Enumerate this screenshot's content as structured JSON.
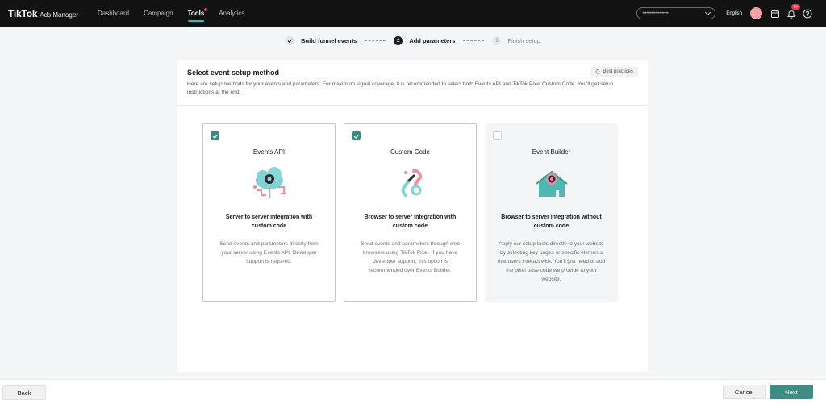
{
  "topbar": {
    "logo_main": "TikTok",
    "logo_sub": "Ads Manager",
    "nav": [
      {
        "label": "Dashboard",
        "active": false
      },
      {
        "label": "Campaign",
        "active": false
      },
      {
        "label": "Tools",
        "active": true
      },
      {
        "label": "Analytics",
        "active": false
      }
    ],
    "account_placeholder": "••••••••••••••••••••",
    "language": "English",
    "notification_count": "9+",
    "accent_color": "#25c2b5"
  },
  "stepper": {
    "steps": [
      {
        "number": "✓",
        "label": "Build funnel events",
        "state": "done"
      },
      {
        "number": "2",
        "label": "Add parameters",
        "state": "current"
      },
      {
        "number": "3",
        "label": "Finish setup",
        "state": "future"
      }
    ]
  },
  "panel": {
    "title": "Select event setup method",
    "best_practices": "Best practices",
    "description": "Here are setup methods for your events and parameters. For maximum signal coverage, it is recommended to select both Events API and TikTok Pixel Custom Code. You'll get setup instructions at the end.",
    "cards": [
      {
        "title": "Events API",
        "subtitle": "Server to server integration with custom code",
        "description": "Send events and parameters directly from your server using Events API. Developer support is required.",
        "checked": true,
        "icon": "cloud-gear-icon"
      },
      {
        "title": "Custom Code",
        "subtitle": "Browser to server integration with custom code",
        "description": "Send events and parameters through web browsers using TikTok Pixel. If you have developer support, this option is recommended over Events Builder.",
        "checked": true,
        "icon": "link-chain-icon"
      },
      {
        "title": "Event Builder",
        "subtitle": "Browser to server integration without custom code",
        "description": "Apply our setup tools directly to your website by selecting key pages or specific elements that users interact with. You'll just need to add the pixel base code we provide to your website.",
        "checked": false,
        "icon": "house-gear-icon"
      }
    ]
  },
  "footer": {
    "back_label": "Back",
    "cancel_label": "Cancel",
    "next_label": "Next",
    "primary_color": "#3f8c84"
  }
}
